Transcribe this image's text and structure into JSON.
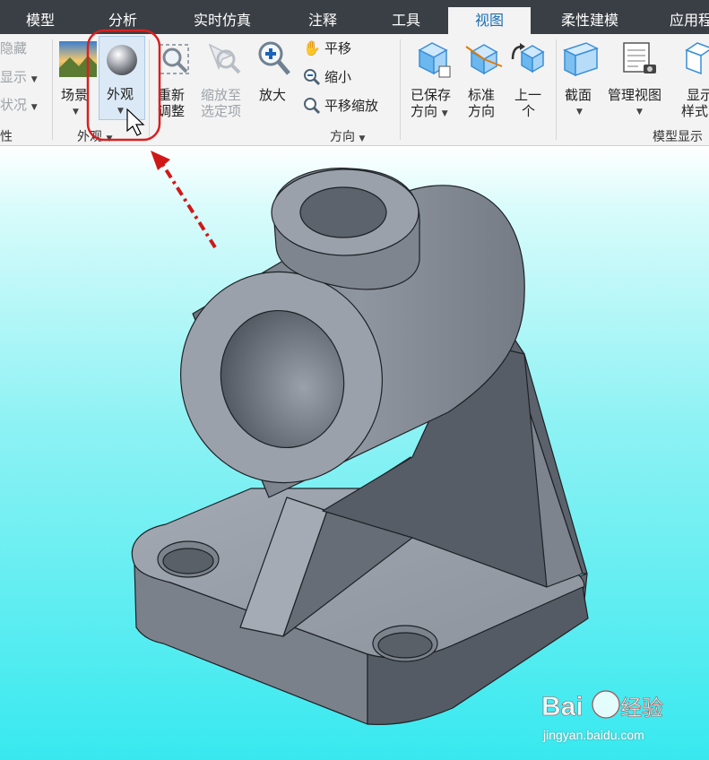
{
  "tabs": [
    {
      "label": "模型"
    },
    {
      "label": "分析"
    },
    {
      "label": "实时仿真"
    },
    {
      "label": "注释"
    },
    {
      "label": "工具"
    },
    {
      "label": "视图",
      "active": true
    },
    {
      "label": "柔性建模"
    },
    {
      "label": "应用程"
    }
  ],
  "ribbon": {
    "left_partial": {
      "hide": "隐藏",
      "display": "显示",
      "status": "状况",
      "group": "性"
    },
    "appearance_group": {
      "scene": "场景",
      "appearance": "外观",
      "label": "外观"
    },
    "orientation_group": {
      "refit_line1": "重新",
      "refit_line2": "调整",
      "zoom_sel_line1": "缩放至",
      "zoom_sel_line2": "选定项",
      "zoom_in": "放大",
      "pan": "平移",
      "zoom_out": "缩小",
      "pan_zoom": "平移缩放",
      "saved_line1": "已保存",
      "saved_line2": "方向",
      "std_line1": "标准",
      "std_line2": "方向",
      "prev_line1": "上一",
      "prev_line2": "个",
      "label": "方向"
    },
    "model_display_group": {
      "section": "截面",
      "manage_views": "管理视图",
      "display_style_line1": "显示",
      "display_style_line2": "样式",
      "label": "模型显示"
    }
  },
  "watermark": {
    "site": "jingyan.baidu.com"
  },
  "colors": {
    "accent": "#1c6fb5",
    "highlight_circle": "#d82020",
    "arrow": "#d01818",
    "tab_bar": "#3a3f45"
  }
}
